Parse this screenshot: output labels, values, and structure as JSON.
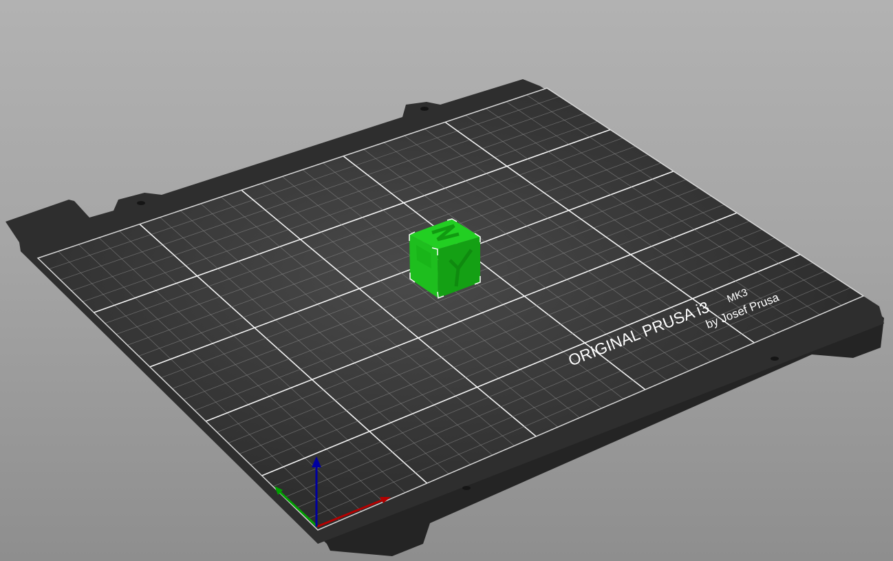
{
  "app": {
    "view": "3D plater viewport"
  },
  "bed": {
    "brand_text": "ORIGINAL PRUSA i3",
    "model_text": "MK3",
    "maker_text": "by Josef Prusa",
    "colors": {
      "sheet": "#2d2d2d",
      "grid_minor": "#8a8a8a",
      "grid_major": "#ffffff",
      "text": "#ffffff"
    }
  },
  "object": {
    "name": "calibration-cube",
    "face_label": "Z",
    "color": "#1fc71f",
    "selected": true
  },
  "axes": {
    "x_color": "#b40000",
    "y_color": "#00a000",
    "z_color": "#0000a0"
  }
}
